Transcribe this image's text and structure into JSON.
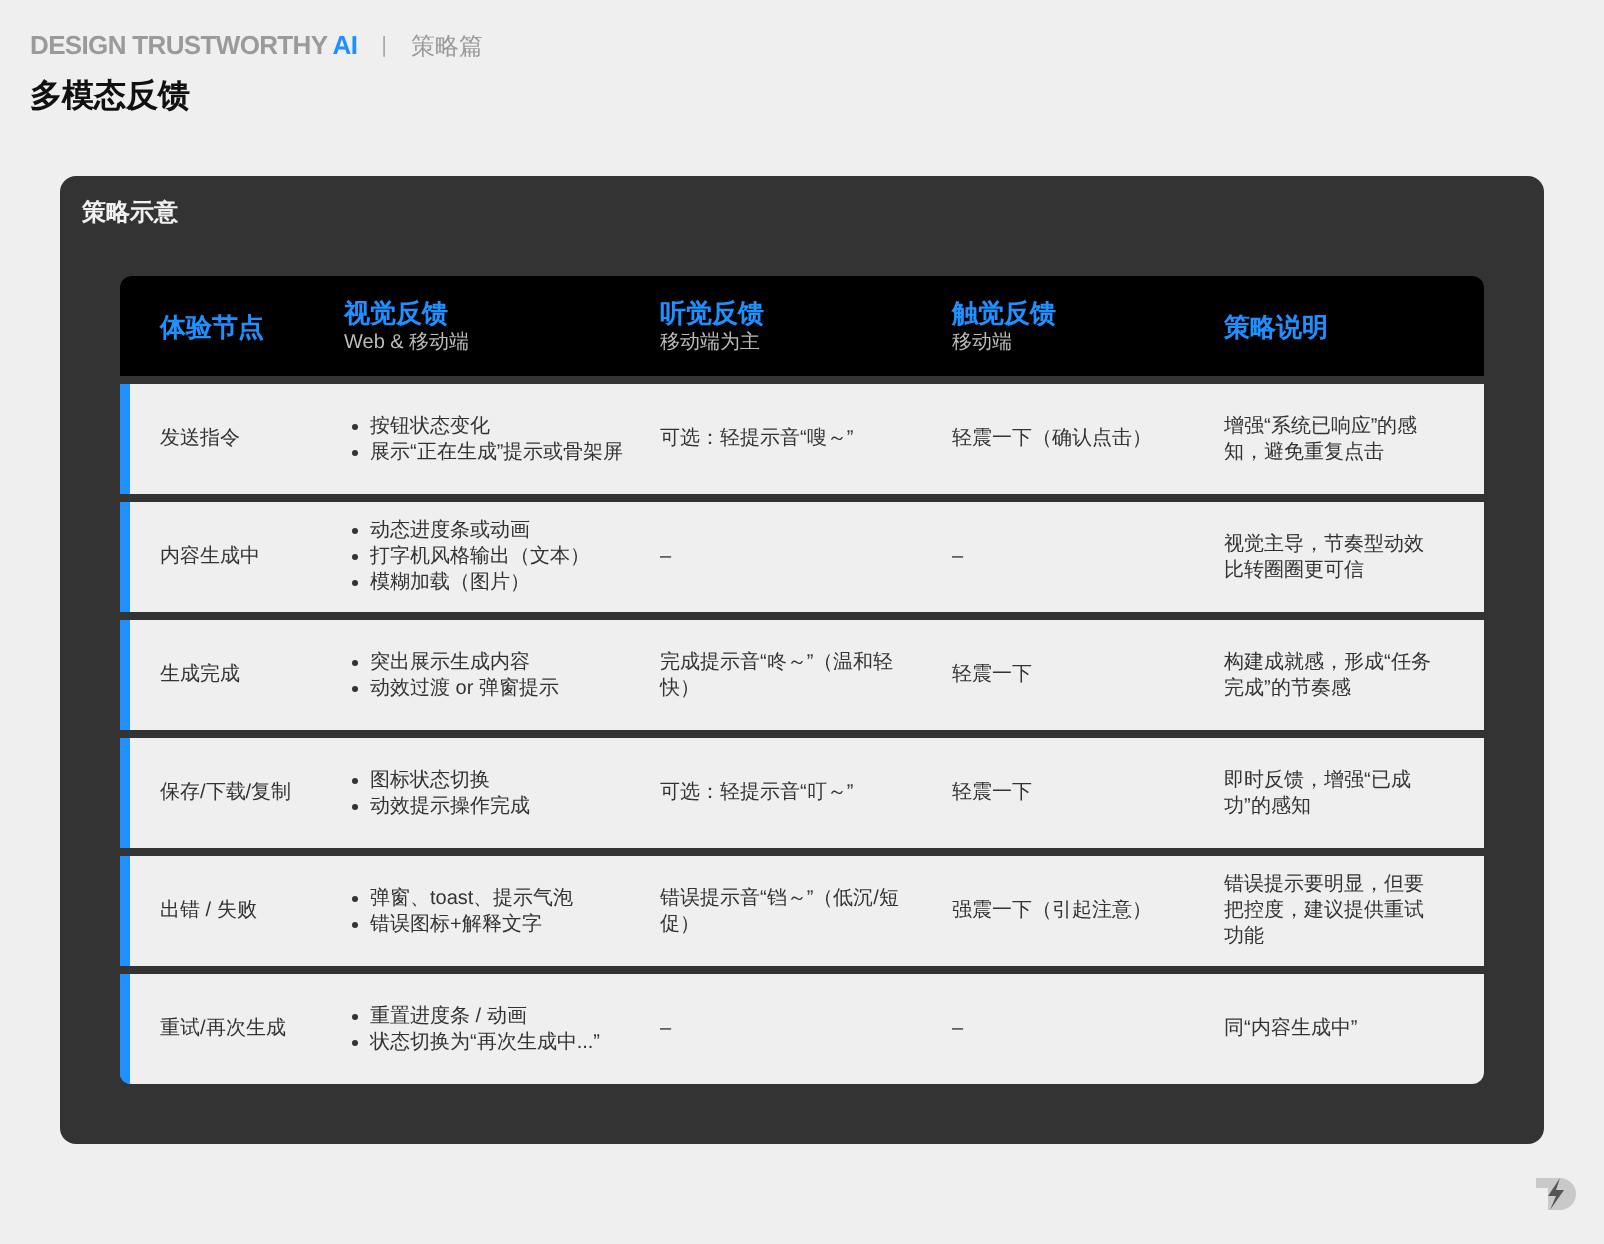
{
  "header": {
    "brand": "DESIGN TRUSTWORTHY",
    "brand_accent": "AI",
    "separator": "|",
    "section": "策略篇"
  },
  "page_title": "多模态反馈",
  "panel": {
    "title": "策略示意",
    "table": {
      "columns": [
        {
          "label": "体验节点"
        },
        {
          "label": "视觉反馈",
          "sub": "Web & 移动端"
        },
        {
          "label": "听觉反馈",
          "sub": "移动端为主"
        },
        {
          "label": "触觉反馈",
          "sub": "移动端"
        },
        {
          "label": "策略说明"
        }
      ],
      "rows": [
        {
          "node": "发送指令",
          "visual": [
            "按钮状态变化",
            "展示“正在生成”提示或骨架屏"
          ],
          "audio": "可选：轻提示音“嗖～”",
          "haptic": "轻震一下（确认点击）",
          "strategy": "增强“系统已响应”的感知，避免重复点击"
        },
        {
          "node": "内容生成中",
          "visual": [
            "动态进度条或动画",
            "打字机风格输出（文本）",
            "模糊加载（图片）"
          ],
          "audio": "–",
          "haptic": "–",
          "strategy": "视觉主导，节奏型动效比转圈圈更可信"
        },
        {
          "node": "生成完成",
          "visual": [
            "突出展示生成内容",
            "动效过渡 or 弹窗提示"
          ],
          "audio": "完成提示音“咚～”（温和轻快）",
          "haptic": "轻震一下",
          "strategy": "构建成就感，形成“任务完成”的节奏感"
        },
        {
          "node": "保存/下载/复制",
          "visual": [
            "图标状态切换",
            "动效提示操作完成"
          ],
          "audio": "可选：轻提示音“叮～”",
          "haptic": "轻震一下",
          "strategy": "即时反馈，增强“已成功”的感知"
        },
        {
          "node": "出错 / 失败",
          "visual": [
            "弹窗、toast、提示气泡",
            "错误图标+解释文字"
          ],
          "audio": "错误提示音“铛～”（低沉/短促）",
          "haptic": "强震一下（引起注意）",
          "strategy": "错误提示要明显，但要把控度，建议提供重试功能"
        },
        {
          "node": "重试/再次生成",
          "visual": [
            "重置进度条 / 动画",
            "状态切换为“再次生成中...”"
          ],
          "audio": "–",
          "haptic": "–",
          "strategy": "同“内容生成中”"
        }
      ]
    }
  }
}
